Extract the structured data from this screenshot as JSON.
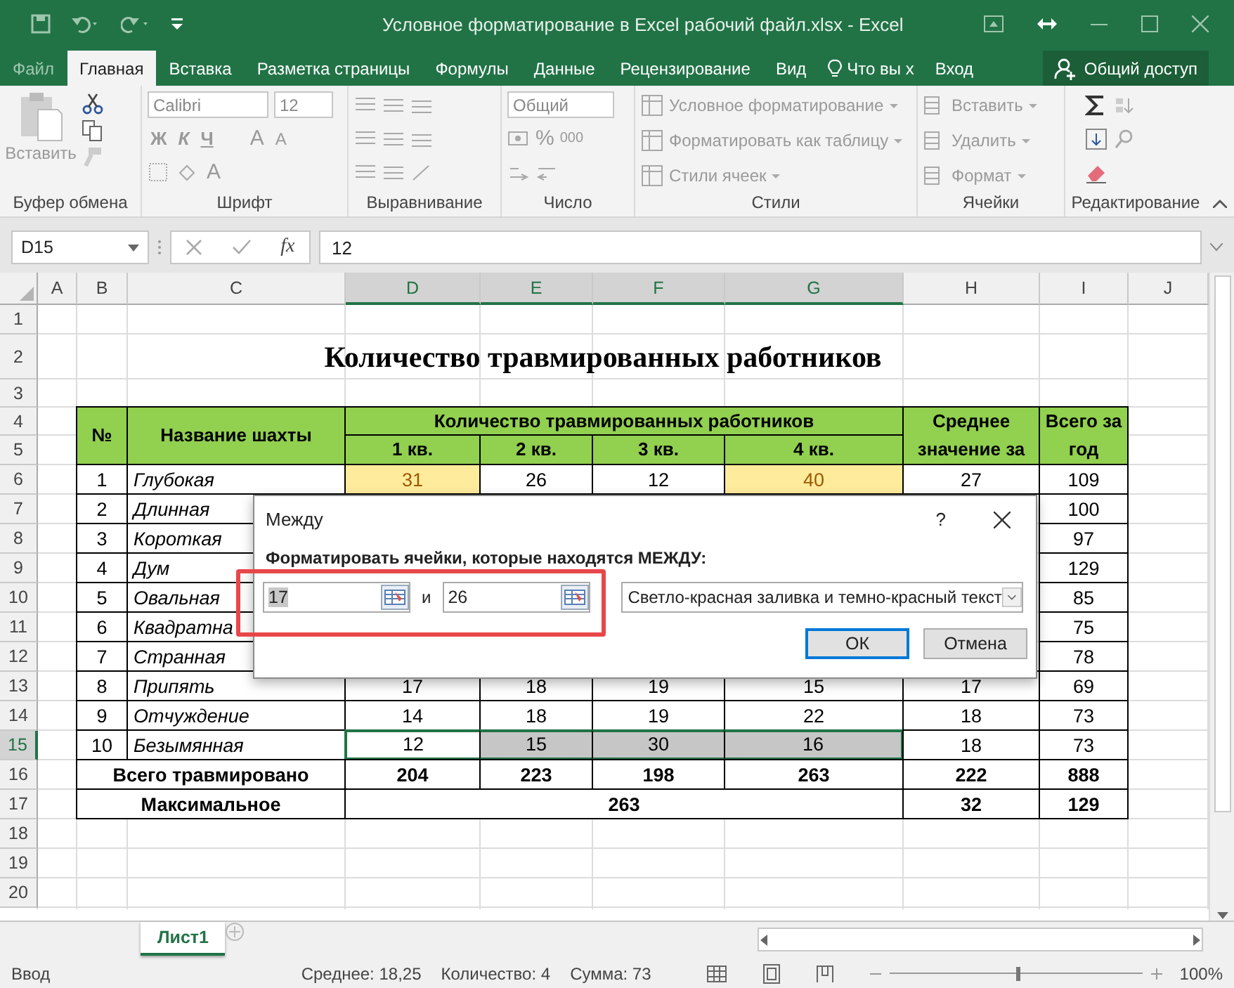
{
  "title_bar": {
    "title": "Условное форматирование в Excel рабочий файл.xlsx - Excel"
  },
  "tabs": [
    {
      "label": "Файл",
      "selected": false,
      "disabled": true
    },
    {
      "label": "Главная",
      "selected": true,
      "disabled": false
    },
    {
      "label": "Вставка",
      "selected": false,
      "disabled": false
    },
    {
      "label": "Разметка страницы",
      "selected": false,
      "disabled": false
    },
    {
      "label": "Формулы",
      "selected": false,
      "disabled": false
    },
    {
      "label": "Данные",
      "selected": false,
      "disabled": false
    },
    {
      "label": "Рецензирование",
      "selected": false,
      "disabled": false
    },
    {
      "label": "Вид",
      "selected": false,
      "disabled": false
    }
  ],
  "tell_me": "Что вы х",
  "sign_in": "Вход",
  "share": "Общий доступ",
  "ribbon": {
    "disabled": true,
    "clipboard": {
      "label": "Буфер обмена",
      "paste": "Вставить"
    },
    "font": {
      "label": "Шрифт",
      "font": "Calibri",
      "size": "12",
      "style_buttons": [
        "Ж",
        "К",
        "Ч"
      ],
      "grow": "A",
      "shrink": "A",
      "font_color_button": "A"
    },
    "alignment": {
      "label": "Выравнивание"
    },
    "number": {
      "label": "Число",
      "format": "Общий",
      "percent": "%",
      "thousands": "000"
    },
    "styles": {
      "label": "Стили",
      "items": [
        "Условное форматирование",
        "Форматировать как таблицу",
        "Стили ячеек"
      ]
    },
    "cells": {
      "label": "Ячейки",
      "items": [
        "Вставить",
        "Удалить",
        "Формат"
      ]
    },
    "editing": {
      "label": "Редактирование"
    }
  },
  "formula_bar": {
    "name_box": "D15",
    "function_label": "fx",
    "value": "12"
  },
  "sheet": {
    "columns": [
      {
        "label": "A",
        "selected": false
      },
      {
        "label": "B",
        "selected": false
      },
      {
        "label": "C",
        "selected": false
      },
      {
        "label": "D",
        "selected": true
      },
      {
        "label": "E",
        "selected": true
      },
      {
        "label": "F",
        "selected": true
      },
      {
        "label": "G",
        "selected": true
      },
      {
        "label": "H",
        "selected": false
      },
      {
        "label": "I",
        "selected": false
      },
      {
        "label": "J",
        "selected": false
      }
    ],
    "rows": [
      {
        "label": "1",
        "selected": false
      },
      {
        "label": "2",
        "selected": false
      },
      {
        "label": "3",
        "selected": false
      },
      {
        "label": "4",
        "selected": false
      },
      {
        "label": "5",
        "selected": false
      },
      {
        "label": "6",
        "selected": false
      },
      {
        "label": "7",
        "selected": false
      },
      {
        "label": "8",
        "selected": false
      },
      {
        "label": "9",
        "selected": false
      },
      {
        "label": "10",
        "selected": false
      },
      {
        "label": "11",
        "selected": false
      },
      {
        "label": "12",
        "selected": false
      },
      {
        "label": "13",
        "selected": false
      },
      {
        "label": "14",
        "selected": false
      },
      {
        "label": "15",
        "selected": true
      },
      {
        "label": "16",
        "selected": false
      },
      {
        "label": "17",
        "selected": false
      },
      {
        "label": "18",
        "selected": false
      },
      {
        "label": "19",
        "selected": false
      },
      {
        "label": "20",
        "selected": false
      }
    ]
  },
  "table": {
    "title": "Количество травмированных работников",
    "header": {
      "number": "№",
      "name": "Название шахты",
      "group": "Количество травмированных работников",
      "quarters": [
        "1 кв.",
        "2 кв.",
        "3 кв.",
        "4 кв."
      ],
      "average": "Среднее значение за",
      "total": "Всего за год"
    },
    "rows": [
      {
        "number": "1",
        "name": "Глубокая",
        "values": [
          {
            "text": "31",
            "selected": false,
            "color": "#ffeb9c"
          },
          {
            "text": "26",
            "selected": false
          },
          {
            "text": "12",
            "selected": false
          },
          {
            "text": "40",
            "selected": false,
            "color": "#ffeb9c"
          }
        ],
        "average": "27",
        "total": "109"
      },
      {
        "number": "2",
        "name": "Длинная",
        "total": "100"
      },
      {
        "number": "3",
        "name": "Короткая",
        "total": "97"
      },
      {
        "number": "4",
        "name": "Дум",
        "total": "129"
      },
      {
        "number": "5",
        "name": "Овальная",
        "total": "85"
      },
      {
        "number": "6",
        "name": "Квадратна",
        "total": "75"
      },
      {
        "number": "7",
        "name": "Странная",
        "total": "78"
      },
      {
        "number": "8",
        "name": "Припять",
        "values": [
          {
            "text": "17",
            "selected": false
          },
          {
            "text": "18",
            "selected": false
          },
          {
            "text": "19",
            "selected": false
          },
          {
            "text": "15",
            "selected": false
          }
        ],
        "average": "17",
        "total": "69"
      },
      {
        "number": "9",
        "name": "Отчуждение",
        "values": [
          {
            "text": "14",
            "selected": false
          },
          {
            "text": "18",
            "selected": false
          },
          {
            "text": "19",
            "selected": false
          },
          {
            "text": "22",
            "selected": false
          }
        ],
        "average": "18",
        "total": "73"
      },
      {
        "number": "10",
        "name": "Безымянная",
        "values": [
          {
            "text": "12",
            "selected": true
          },
          {
            "text": "15",
            "selected": true
          },
          {
            "text": "30",
            "selected": true
          },
          {
            "text": "16",
            "selected": true
          }
        ],
        "average": "18",
        "total": "73"
      }
    ],
    "sum_row": {
      "label": "Всего травмировано",
      "values": [
        "204",
        "223",
        "198",
        "263"
      ],
      "average": "222",
      "total": "888"
    },
    "max_row": {
      "label": "Максимальное",
      "value": "263",
      "average": "32",
      "total": "129"
    }
  },
  "dialog": {
    "title": "Между",
    "help": "?",
    "prompt": "Форматировать ячейки, которые находятся МЕЖДУ:",
    "from": "17",
    "conjunction": "и",
    "to": "26",
    "format": "Светло-красная заливка и темно-красный текст",
    "buttons": [
      {
        "label": "ОК",
        "default": true
      },
      {
        "label": "Отмена",
        "default": false
      }
    ]
  },
  "sheet_tabs": [
    {
      "label": "Лист1",
      "selected": true
    }
  ],
  "status_bar": {
    "mode": "Ввод",
    "stats": [
      "Среднее: 18,25",
      "Количество: 4",
      "Сумма: 73"
    ],
    "zoom": {
      "level": 0.5,
      "reading": "100%"
    }
  }
}
